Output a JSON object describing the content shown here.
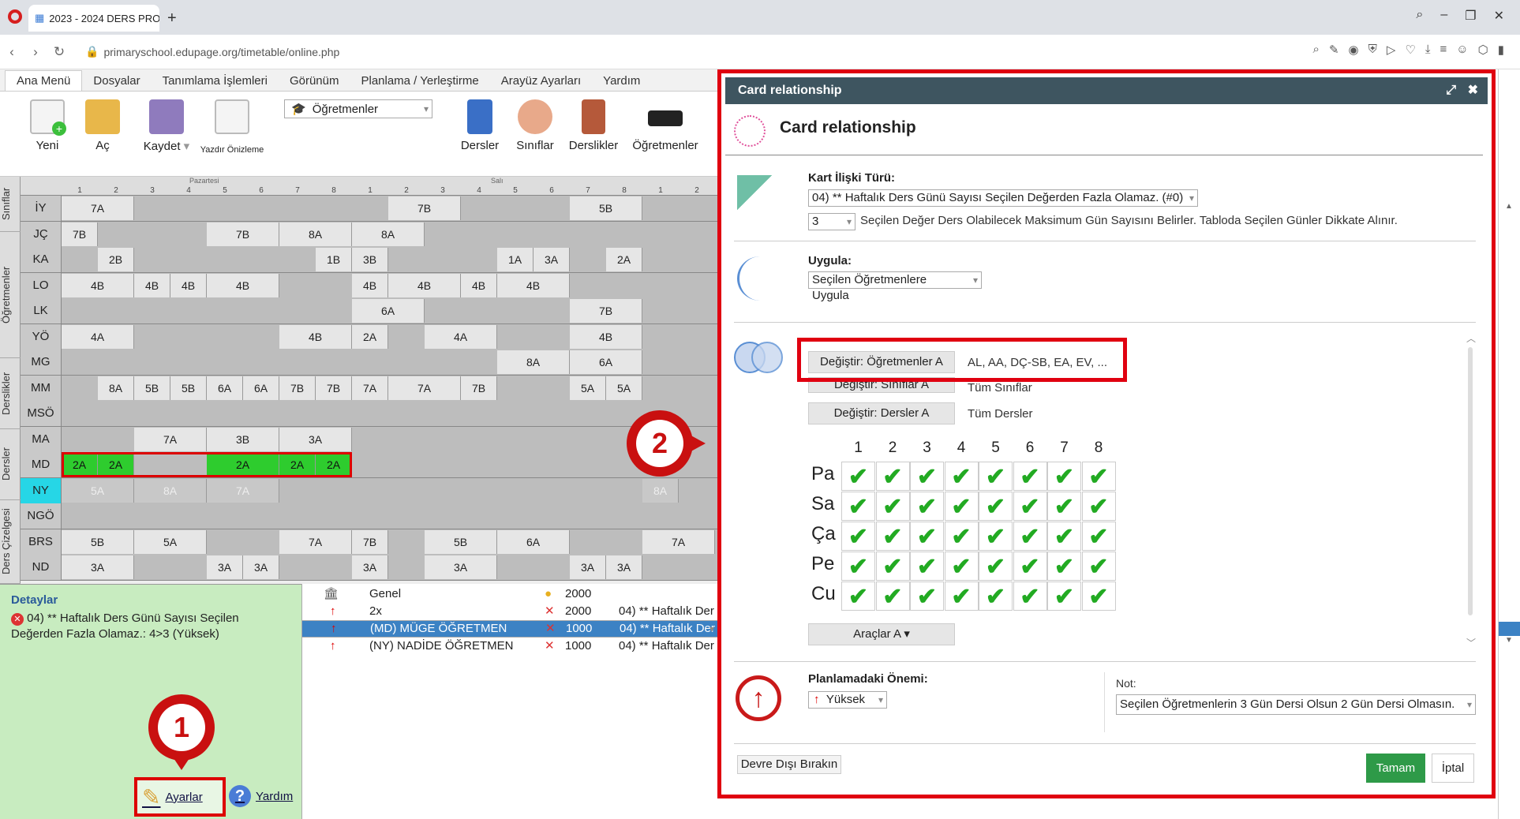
{
  "browser": {
    "tab_title": "2023 - 2024 DERS PROGR",
    "url": "primaryschool.edupage.org/timetable/online.php"
  },
  "menu": [
    "Ana Menü",
    "Dosyalar",
    "Tanımlama İşlemleri",
    "Görünüm",
    "Planlama / Yerleştirme",
    "Arayüz Ayarları",
    "Yardım"
  ],
  "toolbar": {
    "yeni": "Yeni",
    "ac": "Aç",
    "kaydet": "Kaydet",
    "yazdir": "Yazdır Önizleme",
    "ogretmenler_select": "Öğretmenler",
    "dersler": "Dersler",
    "siniflar": "Sınıflar",
    "derslikler": "Derslikler",
    "ogretmenler": "Öğretmenler"
  },
  "side_tabs": [
    "Sınıflar",
    "Öğretmenler",
    "Derslikler",
    "Dersler",
    "Ders Çizelgesi"
  ],
  "grid": {
    "day1": "Pazartesi",
    "day2": "Salı",
    "periods": [
      "1",
      "2",
      "3",
      "4",
      "5",
      "6",
      "7",
      "8"
    ],
    "rows": [
      {
        "code": "İY",
        "cells": [
          {
            "p": 0,
            "w": 2,
            "t": "7A"
          },
          {
            "p": 9,
            "w": 2,
            "t": "7B"
          },
          {
            "p": 14,
            "w": 2,
            "t": "5B"
          }
        ]
      },
      {
        "code": "JÇ",
        "cells": [
          {
            "p": 0,
            "w": 1,
            "t": "7B"
          },
          {
            "p": 4,
            "w": 2,
            "t": "7B"
          },
          {
            "p": 6,
            "w": 2,
            "t": "8A"
          },
          {
            "p": 8,
            "w": 2,
            "t": "8A"
          }
        ]
      },
      {
        "code": "KA",
        "cells": [
          {
            "p": 1,
            "w": 1,
            "t": "2B"
          },
          {
            "p": 7,
            "w": 1,
            "t": "1B"
          },
          {
            "p": 8,
            "w": 1,
            "t": "3B"
          },
          {
            "p": 12,
            "w": 1,
            "t": "1A"
          },
          {
            "p": 13,
            "w": 1,
            "t": "3A"
          },
          {
            "p": 15,
            "w": 1,
            "t": "2A"
          }
        ]
      },
      {
        "code": "LO",
        "cells": [
          {
            "p": 0,
            "w": 2,
            "t": "4B"
          },
          {
            "p": 2,
            "w": 1,
            "t": "4B"
          },
          {
            "p": 3,
            "w": 1,
            "t": "4B"
          },
          {
            "p": 4,
            "w": 2,
            "t": "4B"
          },
          {
            "p": 8,
            "w": 1,
            "t": "4B"
          },
          {
            "p": 9,
            "w": 2,
            "t": "4B"
          },
          {
            "p": 11,
            "w": 1,
            "t": "4B"
          },
          {
            "p": 12,
            "w": 2,
            "t": "4B"
          }
        ]
      },
      {
        "code": "LK",
        "cells": [
          {
            "p": 8,
            "w": 2,
            "t": "6A"
          },
          {
            "p": 14,
            "w": 2,
            "t": "7B"
          }
        ]
      },
      {
        "code": "YÖ",
        "cells": [
          {
            "p": 0,
            "w": 2,
            "t": "4A"
          },
          {
            "p": 6,
            "w": 2,
            "t": "4B"
          },
          {
            "p": 8,
            "w": 1,
            "t": "2A"
          },
          {
            "p": 10,
            "w": 2,
            "t": "4A"
          },
          {
            "p": 14,
            "w": 2,
            "t": "4B"
          }
        ]
      },
      {
        "code": "MG",
        "cells": [
          {
            "p": 12,
            "w": 2,
            "t": "8A"
          },
          {
            "p": 14,
            "w": 2,
            "t": "6A"
          }
        ]
      },
      {
        "code": "MM",
        "cells": [
          {
            "p": 1,
            "w": 1,
            "t": "8A"
          },
          {
            "p": 2,
            "w": 1,
            "t": "5B"
          },
          {
            "p": 3,
            "w": 1,
            "t": "5B"
          },
          {
            "p": 4,
            "w": 1,
            "t": "6A"
          },
          {
            "p": 5,
            "w": 1,
            "t": "6A"
          },
          {
            "p": 6,
            "w": 1,
            "t": "7B"
          },
          {
            "p": 7,
            "w": 1,
            "t": "7B"
          },
          {
            "p": 8,
            "w": 1,
            "t": "7A"
          },
          {
            "p": 9,
            "w": 2,
            "t": "7A"
          },
          {
            "p": 11,
            "w": 1,
            "t": "7B"
          },
          {
            "p": 14,
            "w": 1,
            "t": "5A"
          },
          {
            "p": 15,
            "w": 1,
            "t": "5A"
          }
        ]
      },
      {
        "code": "MSÖ",
        "cells": []
      },
      {
        "code": "MA",
        "cells": [
          {
            "p": 2,
            "w": 2,
            "t": "7A"
          },
          {
            "p": 4,
            "w": 2,
            "t": "3B"
          },
          {
            "p": 6,
            "w": 2,
            "t": "3A"
          }
        ]
      },
      {
        "code": "MD",
        "cells": [
          {
            "p": 0,
            "w": 1,
            "t": "2A",
            "g": 1
          },
          {
            "p": 1,
            "w": 1,
            "t": "2A",
            "g": 1
          },
          {
            "p": 4,
            "w": 2,
            "t": "2A",
            "g": 1
          },
          {
            "p": 6,
            "w": 1,
            "t": "2A",
            "g": 1
          },
          {
            "p": 7,
            "w": 1,
            "t": "2A",
            "g": 1
          }
        ]
      },
      {
        "code": "NY",
        "cells": [
          {
            "p": 0,
            "w": 2,
            "t": "5A",
            "f": 1
          },
          {
            "p": 2,
            "w": 2,
            "t": "8A",
            "f": 1
          },
          {
            "p": 4,
            "w": 2,
            "t": "7A",
            "f": 1
          },
          {
            "p": 16,
            "w": 1,
            "t": "8A",
            "f": 1
          }
        ]
      },
      {
        "code": "NGÖ",
        "cells": []
      },
      {
        "code": "BRS",
        "cells": [
          {
            "p": 0,
            "w": 2,
            "t": "5B"
          },
          {
            "p": 2,
            "w": 2,
            "t": "5A"
          },
          {
            "p": 6,
            "w": 2,
            "t": "7A"
          },
          {
            "p": 8,
            "w": 1,
            "t": "7B"
          },
          {
            "p": 10,
            "w": 2,
            "t": "5B"
          },
          {
            "p": 12,
            "w": 2,
            "t": "6A"
          },
          {
            "p": 16,
            "w": 2,
            "t": "7A"
          }
        ]
      },
      {
        "code": "ND",
        "cells": [
          {
            "p": 0,
            "w": 2,
            "t": "3A"
          },
          {
            "p": 4,
            "w": 1,
            "t": "3A"
          },
          {
            "p": 5,
            "w": 1,
            "t": "3A"
          },
          {
            "p": 8,
            "w": 1,
            "t": "3A"
          },
          {
            "p": 10,
            "w": 2,
            "t": "3A"
          },
          {
            "p": 14,
            "w": 1,
            "t": "3A"
          },
          {
            "p": 15,
            "w": 1,
            "t": "3A"
          }
        ]
      }
    ]
  },
  "details": {
    "title": "Detaylar",
    "text": "04) ** Haftalık Ders Günü Sayısı Seçilen Değerden Fazla Olamaz.: 4>3 (Yüksek)"
  },
  "list": [
    {
      "name": "Genel",
      "score": "2000",
      "desc": ""
    },
    {
      "name": "2x",
      "score": "2000",
      "desc": "04) ** Haftalık Der"
    },
    {
      "name": "(MD) MÜGE ÖĞRETMEN",
      "score": "1000",
      "desc": "04) ** Haftalık Der"
    },
    {
      "name": "(NY) NADİDE ÖĞRETMEN",
      "score": "1000",
      "desc": "04) ** Haftalık Der"
    }
  ],
  "footer": {
    "ayarlar": "Ayarlar",
    "yardim": "Yardım"
  },
  "pins": {
    "one": "1",
    "two": "2"
  },
  "dialog": {
    "header": "Card relationship",
    "title": "Card relationship",
    "kart_label": "Kart İlişki Türü:",
    "kart_value": "04) ** Haftalık Ders Günü Sayısı Seçilen Değerden Fazla Olamaz. (#0)",
    "num_value": "3",
    "num_desc": "Seçilen Değer Ders Olabilecek Maksimum Gün Sayısını Belirler. Tabloda Seçilen Günler Dikkate Alınır.",
    "uygula_label": "Uygula:",
    "uygula_value": "Seçilen Öğretmenlere Uygula",
    "ogretmen_btn": "Değiştir: Öğretmenler A",
    "ogretmen_val": "AL, AA, DÇ-SB, EA, EV, ...",
    "sinif_btn": "Değiştir: Sınıflar A",
    "sinif_val": "Tüm Sınıflar",
    "ders_btn": "Değiştir: Dersler A",
    "ders_val": "Tüm Dersler",
    "periods": [
      "1",
      "2",
      "3",
      "4",
      "5",
      "6",
      "7",
      "8"
    ],
    "days": [
      "Pa",
      "Sa",
      "Ça",
      "Pe",
      "Cu"
    ],
    "araclar": "Araçlar A ▾",
    "onem_label": "Planlamadaki Önemi:",
    "onem_value": "Yüksek",
    "not_label": "Not:",
    "not_value": "Seçilen Öğretmenlerin 3 Gün Dersi Olsun 2 Gün Dersi Olmasın.",
    "devre": "Devre Dışı Bırakın",
    "ok": "Tamam",
    "cancel": "İptal"
  }
}
